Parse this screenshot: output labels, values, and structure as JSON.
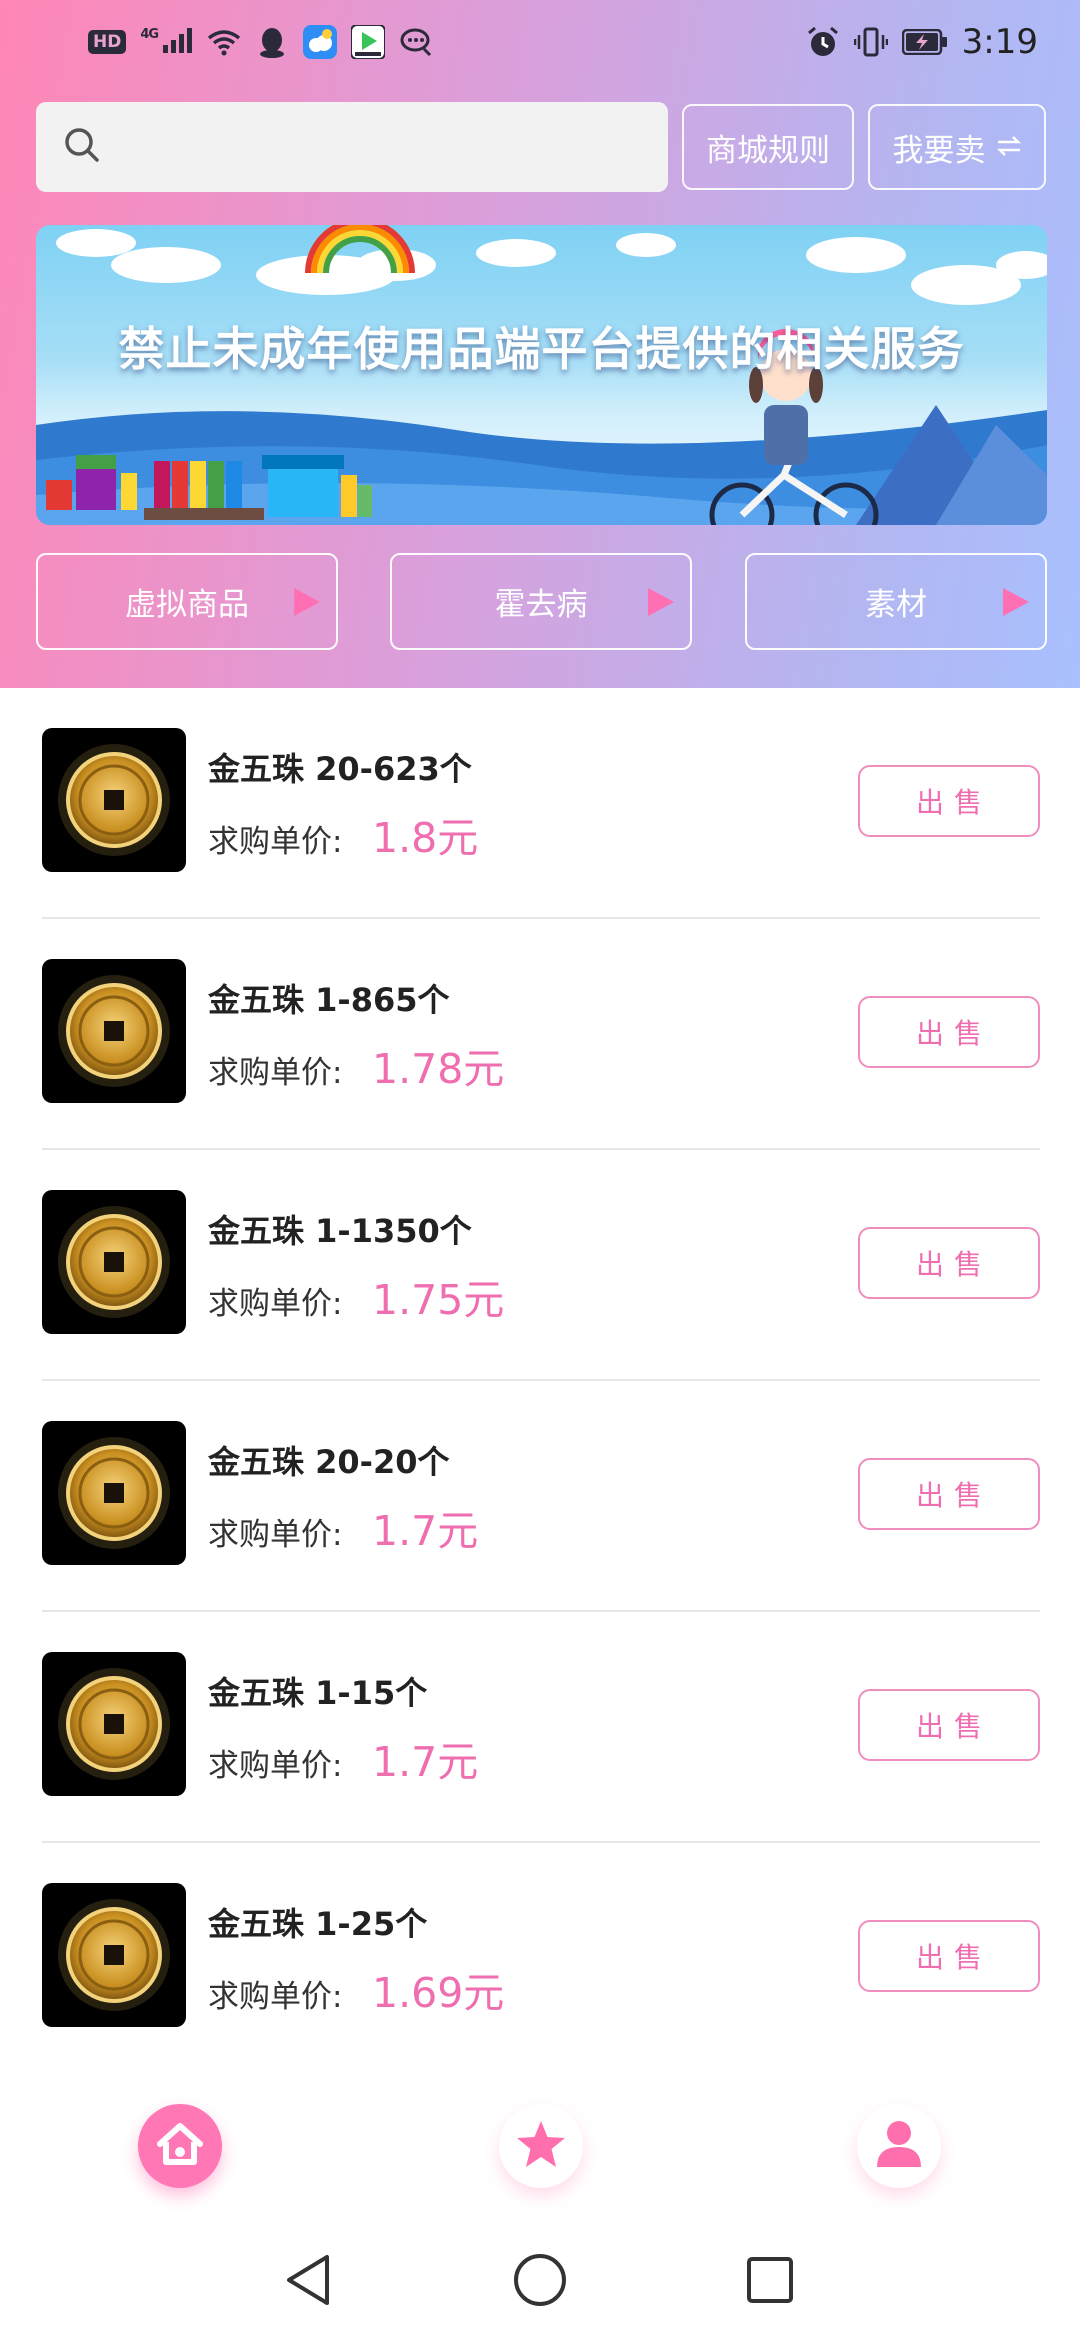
{
  "status_bar": {
    "hd": "HD",
    "signal": "4G",
    "time": "3:19"
  },
  "search": {
    "placeholder": ""
  },
  "header_buttons": {
    "rules_label": "商城规则",
    "sell_label": "我要卖"
  },
  "banner": {
    "text": "禁止未成年使用品端平台提供的相关服务"
  },
  "categories": [
    {
      "label": "虚拟商品"
    },
    {
      "label": "霍去病"
    },
    {
      "label": "素材"
    }
  ],
  "items": [
    {
      "name": "金五珠 20-623个",
      "price_label": "求购单价:",
      "price": "1.8元",
      "action": "出售"
    },
    {
      "name": "金五珠 1-865个",
      "price_label": "求购单价:",
      "price": "1.78元",
      "action": "出售"
    },
    {
      "name": "金五珠 1-1350个",
      "price_label": "求购单价:",
      "price": "1.75元",
      "action": "出售"
    },
    {
      "name": "金五珠 20-20个",
      "price_label": "求购单价:",
      "price": "1.7元",
      "action": "出售"
    },
    {
      "name": "金五珠 1-15个",
      "price_label": "求购单价:",
      "price": "1.7元",
      "action": "出售"
    },
    {
      "name": "金五珠 1-25个",
      "price_label": "求购单价:",
      "price": "1.69元",
      "action": "出售"
    }
  ],
  "bottom_nav": [
    {
      "icon": "home-icon",
      "active": true
    },
    {
      "icon": "star-icon",
      "active": false
    },
    {
      "icon": "user-icon",
      "active": false
    }
  ],
  "colors": {
    "accent": "#ef6eb0",
    "gradient_start": "#ff86b6",
    "gradient_end": "#a8c0ff"
  }
}
